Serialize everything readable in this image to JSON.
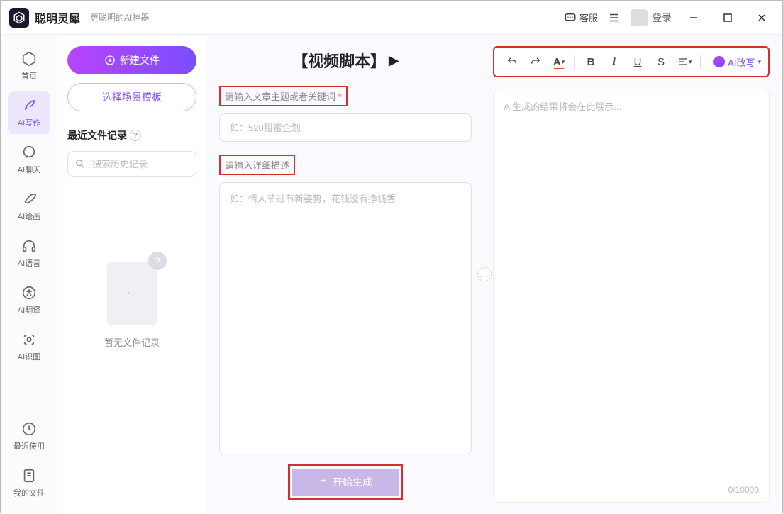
{
  "titlebar": {
    "app_name": "聪明灵犀",
    "app_subtitle": "更聪明的AI神器",
    "kefu_label": "客服",
    "login_label": "登录"
  },
  "sidebar": {
    "items": [
      {
        "label": "首页",
        "icon": "home"
      },
      {
        "label": "AI写作",
        "icon": "feather"
      },
      {
        "label": "AI聊天",
        "icon": "chat"
      },
      {
        "label": "AI绘画",
        "icon": "brush"
      },
      {
        "label": "AI语音",
        "icon": "headphones"
      },
      {
        "label": "AI翻译",
        "icon": "translate"
      },
      {
        "label": "AI识图",
        "icon": "image-scan"
      }
    ],
    "bottom": [
      {
        "label": "最近使用",
        "icon": "clock"
      },
      {
        "label": "我的文件",
        "icon": "file"
      }
    ]
  },
  "leftpanel": {
    "new_file": "新建文件",
    "choose_template": "选择场景模板",
    "recent_title": "最近文件记录",
    "search_placeholder": "搜索历史记录",
    "empty_text": "暂无文件记录"
  },
  "center": {
    "title": "【视频脚本】",
    "label1": "请输入文章主题或者关键词",
    "input1_placeholder": "如：520甜蜜企划",
    "label2": "请输入详细描述",
    "textarea_placeholder": "如：情人节过节新姿势，花钱没有挣钱香",
    "generate": "开始生成"
  },
  "right": {
    "ai_rewrite": "AI改写",
    "result_placeholder": "AI生成的结果将会在此展示...",
    "counter": "0/10000"
  }
}
